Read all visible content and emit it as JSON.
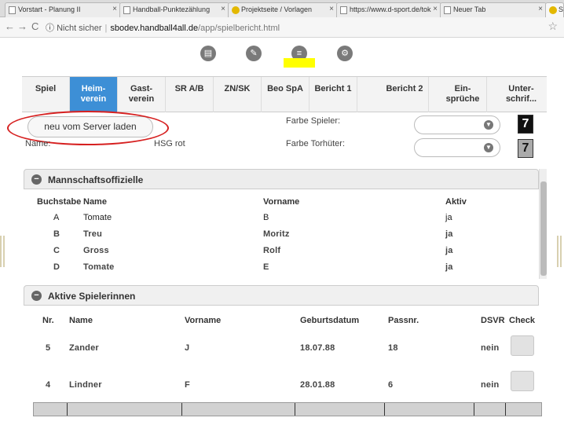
{
  "browser": {
    "tabs": [
      {
        "title": "Vorstart - Planung II",
        "active": false
      },
      {
        "title": "Handball-Punktezählung",
        "active": false
      },
      {
        "title": "Projektseite / Vorlagen",
        "active": false
      },
      {
        "title": "https://www.d-sport.de/tok",
        "active": false
      },
      {
        "title": "Neuer Tab",
        "active": false
      },
      {
        "title": "S",
        "active": true
      }
    ],
    "url_security": "Nicht sicher",
    "url_host": "sbodev.handball4all.de",
    "url_path": "/app/spielbericht.html"
  },
  "toolbar_icons": [
    "menu-icon",
    "pencil-icon",
    "list-icon",
    "gear-icon"
  ],
  "nav_tabs": [
    {
      "label": "Spiel",
      "active": false
    },
    {
      "label": "Heim-verein",
      "active": true
    },
    {
      "label": "Gast-verein",
      "active": false
    },
    {
      "label": "SR A/B",
      "active": false
    },
    {
      "label": "ZN/SK",
      "active": false
    },
    {
      "label": "Beo SpA",
      "active": false
    },
    {
      "label": "Bericht 1",
      "active": false
    },
    {
      "label": "Bericht 2",
      "active": false
    },
    {
      "label": "Ein-sprüche",
      "active": false
    },
    {
      "label": "Unter-schrif..."
    }
  ],
  "form": {
    "reload_button": "neu vom Server laden",
    "name_label": "Name:",
    "name_value": "HSG rot",
    "player_color_label": "Farbe Spieler:",
    "keeper_color_label": "Farbe Torhüter:",
    "player_number": "7",
    "keeper_number": "7"
  },
  "officials": {
    "title": "Mannschaftsoffizielle",
    "columns": [
      "Buchstabe",
      "Name",
      "Vorname",
      "Aktiv"
    ],
    "rows": [
      {
        "letter": "A",
        "name": "Tomate",
        "firstname": "B",
        "active": "ja"
      },
      {
        "letter": "B",
        "name": "Treu",
        "firstname": "Moritz",
        "active": "ja"
      },
      {
        "letter": "C",
        "name": "Gross",
        "firstname": "Rolf",
        "active": "ja"
      },
      {
        "letter": "D",
        "name": "Tomate",
        "firstname": "E",
        "active": "ja"
      }
    ]
  },
  "players": {
    "title": "Aktive Spielerinnen",
    "columns": [
      "Nr.",
      "Name",
      "Vorname",
      "Geburtsdatum",
      "Passnr.",
      "DSVR",
      "Check"
    ],
    "rows": [
      {
        "nr": "5",
        "name": "Zander",
        "firstname": "J",
        "birth": "18.07.88",
        "pass": "18",
        "dsvr": "nein"
      },
      {
        "nr": "4",
        "name": "Lindner",
        "firstname": "F",
        "birth": "28.01.88",
        "pass": "6",
        "dsvr": "nein"
      }
    ]
  },
  "colors": {
    "accent": "#3d8fd6",
    "highlight": "#ffff00",
    "annotation": "#d62020"
  }
}
